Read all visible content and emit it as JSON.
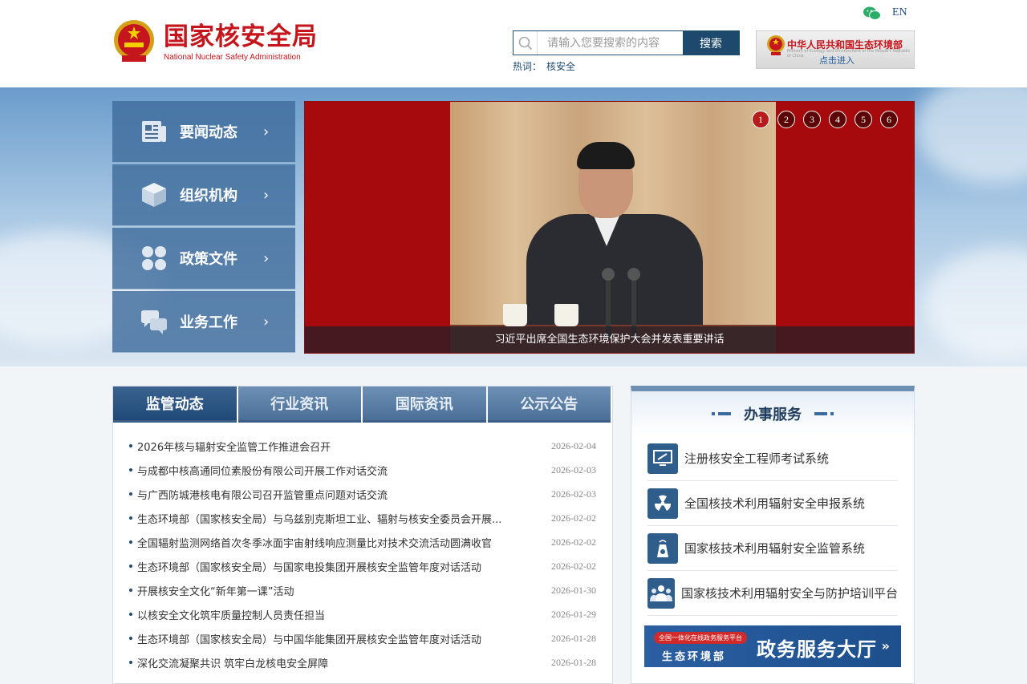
{
  "header": {
    "logo_cn": "国家核安全局",
    "logo_en": "National Nuclear Safety Administration",
    "en_link": "EN",
    "search_placeholder": "请输入您要搜索的内容",
    "search_button": "搜索",
    "hot_label": "热词：",
    "hot_word": "核安全",
    "mee_title": "中华人民共和国生态环境部",
    "mee_sub": "Ministry of Ecology and Environment of the People's Republic of China",
    "mee_enter": "点击进入"
  },
  "side_nav": [
    {
      "label": "要闻动态",
      "icon": "newspaper-icon"
    },
    {
      "label": "组织机构",
      "icon": "cube-icon"
    },
    {
      "label": "政策文件",
      "icon": "clover-icon"
    },
    {
      "label": "业务工作",
      "icon": "chat-bubbles-icon"
    }
  ],
  "slider": {
    "caption": "习近平出席全国生态环境保护大会并发表重要讲话",
    "dots": [
      "1",
      "2",
      "3",
      "4",
      "5",
      "6"
    ],
    "active_dot": "1"
  },
  "news": {
    "tabs": [
      "监管动态",
      "行业资讯",
      "国际资讯",
      "公示公告"
    ],
    "active_tab": "监管动态",
    "items": [
      {
        "title": "2026年核与辐射安全监管工作推进会召开",
        "date": "2026-02-04"
      },
      {
        "title": "与成都中核高通同位素股份有限公司开展工作对话交流",
        "date": "2026-02-03"
      },
      {
        "title": "与广西防城港核电有限公司召开监管重点问题对话交流",
        "date": "2026-02-03"
      },
      {
        "title": "生态环境部（国家核安全局）与乌兹别克斯坦工业、辐射与核安全委员会开展...",
        "date": "2026-02-02"
      },
      {
        "title": "全国辐射监测网络首次冬季冰面宇宙射线响应测量比对技术交流活动圆满收官",
        "date": "2026-02-02"
      },
      {
        "title": "生态环境部（国家核安全局）与国家电投集团开展核安全监管年度对话活动",
        "date": "2026-02-02"
      },
      {
        "title": "开展核安全文化“新年第一课”活动",
        "date": "2026-01-30"
      },
      {
        "title": "以核安全文化筑牢质量控制人员责任担当",
        "date": "2026-01-29"
      },
      {
        "title": "生态环境部（国家核安全局）与中国华能集团开展核安全监管年度对话活动",
        "date": "2026-01-28"
      },
      {
        "title": "深化交流凝聚共识 筑牢白龙核电安全屏障",
        "date": "2026-01-28"
      }
    ]
  },
  "service": {
    "title": "办事服务",
    "items": [
      {
        "label": "注册核安全工程师考试系统",
        "icon": "exam-monitor-icon"
      },
      {
        "label": "全国核技术利用辐射安全申报系统",
        "icon": "radiation-icon"
      },
      {
        "label": "国家核技术利用辐射安全监管系统",
        "icon": "nuclear-plant-icon"
      },
      {
        "label": "国家核技术利用辐射安全与防护培训平台",
        "icon": "people-training-icon"
      }
    ],
    "banner_tag": "全国一体化在线政务服务平台",
    "banner_ministry": "生态环境部",
    "banner_title": "政务服务大厅",
    "banner_arrow": "»"
  },
  "colors": {
    "brand_red": "#c4161c",
    "nav_blue": "#1d4a6c",
    "tab_active": "#1f4a77"
  }
}
